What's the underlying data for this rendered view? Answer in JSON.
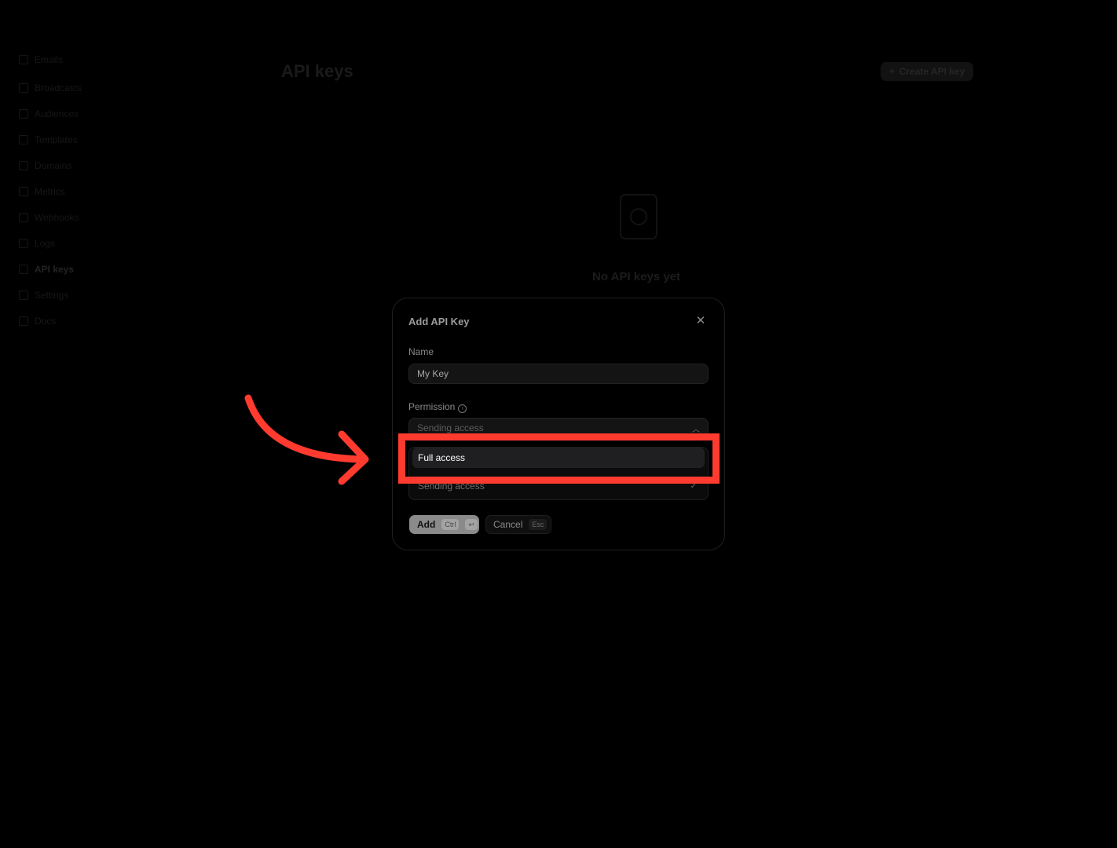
{
  "sidebar": {
    "workspace": "",
    "items": [
      {
        "label": "Emails"
      },
      {
        "label": "Broadcasts"
      },
      {
        "label": "Audiences"
      },
      {
        "label": "Templates"
      },
      {
        "label": "Domains"
      },
      {
        "label": "Metrics"
      },
      {
        "label": "Webhooks"
      },
      {
        "label": "Logs"
      },
      {
        "label": "API keys"
      },
      {
        "label": "Settings"
      },
      {
        "label": "Docs"
      }
    ],
    "footer": ""
  },
  "header": {
    "title": "API keys",
    "create_label": "Create API key"
  },
  "empty_state": {
    "text": "No API keys yet"
  },
  "modal": {
    "title": "Add API Key",
    "name_label": "Name",
    "name_value": "My Key",
    "permission_label": "Permission",
    "permission_value": "Sending access",
    "options": [
      {
        "label": "Full access",
        "highlighted": true
      },
      {
        "label": "Sending access",
        "selected": true
      }
    ],
    "add_label": "Add",
    "add_shortcut": "Ctrl",
    "cancel_label": "Cancel",
    "cancel_shortcut": "Esc"
  },
  "annotation": {
    "color": "#ff3b30"
  }
}
